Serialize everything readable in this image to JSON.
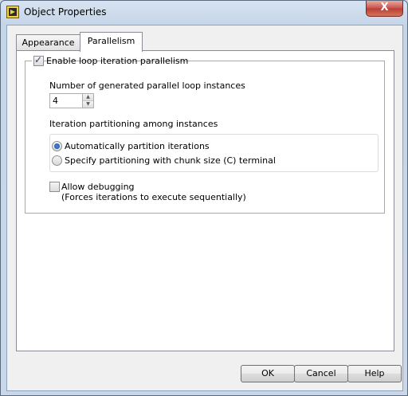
{
  "window": {
    "title": "Object Properties",
    "close_symbol": "X"
  },
  "tabs": [
    {
      "label": "Appearance",
      "selected": false
    },
    {
      "label": "Parallelism",
      "selected": true
    }
  ],
  "parallelism": {
    "enable_label": "Enable loop iteration parallelism",
    "enable_checked": true,
    "instances_label": "Number of generated parallel loop instances",
    "instances_value": "4",
    "partition_heading": "Iteration partitioning among instances",
    "options": [
      {
        "label": "Automatically partition iterations",
        "selected": true
      },
      {
        "label": "Specify partitioning with chunk size (C) terminal",
        "selected": false
      }
    ],
    "debug_label": "Allow debugging",
    "debug_note": "(Forces iterations to execute sequentially)",
    "debug_checked": false
  },
  "buttons": {
    "ok": "OK",
    "cancel": "Cancel",
    "help": "Help"
  },
  "icons": {
    "app": "labview-app-icon",
    "check": "✓"
  }
}
